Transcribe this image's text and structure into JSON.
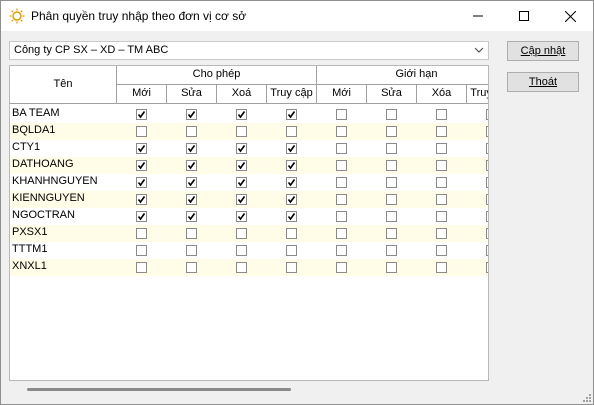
{
  "window": {
    "title": "Phân quyền truy nhập theo đơn vị cơ sở"
  },
  "company_select": {
    "value": "Công ty CP SX – XD – TM ABC"
  },
  "buttons": {
    "update_label": "Cập nhật",
    "exit_label": "Thoát"
  },
  "grid": {
    "name_header": "Tên",
    "groups": [
      "Cho phép",
      "Giới hạn"
    ],
    "subcolumns": [
      "Mới",
      "Sửa",
      "Xoá",
      "Truy cập",
      "Mới",
      "Sửa",
      "Xóa",
      "Truy cập"
    ],
    "rows": [
      {
        "name": "BA TEAM",
        "checks": [
          true,
          true,
          true,
          true,
          false,
          false,
          false,
          false
        ]
      },
      {
        "name": "BQLDA1",
        "checks": [
          false,
          false,
          false,
          false,
          false,
          false,
          false,
          false
        ]
      },
      {
        "name": "CTY1",
        "checks": [
          true,
          true,
          true,
          true,
          false,
          false,
          false,
          false
        ]
      },
      {
        "name": "DATHOANG",
        "checks": [
          true,
          true,
          true,
          true,
          false,
          false,
          false,
          false
        ]
      },
      {
        "name": "KHANHNGUYEN",
        "checks": [
          true,
          true,
          true,
          true,
          false,
          false,
          false,
          false
        ]
      },
      {
        "name": "KIENNGUYEN",
        "checks": [
          true,
          true,
          true,
          true,
          false,
          false,
          false,
          false
        ]
      },
      {
        "name": "NGOCTRAN",
        "checks": [
          true,
          true,
          true,
          true,
          false,
          false,
          false,
          false
        ]
      },
      {
        "name": "PXSX1",
        "checks": [
          false,
          false,
          false,
          false,
          false,
          false,
          false,
          false
        ]
      },
      {
        "name": "TTTM1",
        "checks": [
          false,
          false,
          false,
          false,
          false,
          false,
          false,
          false
        ]
      },
      {
        "name": "XNXL1",
        "checks": [
          false,
          false,
          false,
          false,
          false,
          false,
          false,
          false
        ]
      }
    ]
  }
}
